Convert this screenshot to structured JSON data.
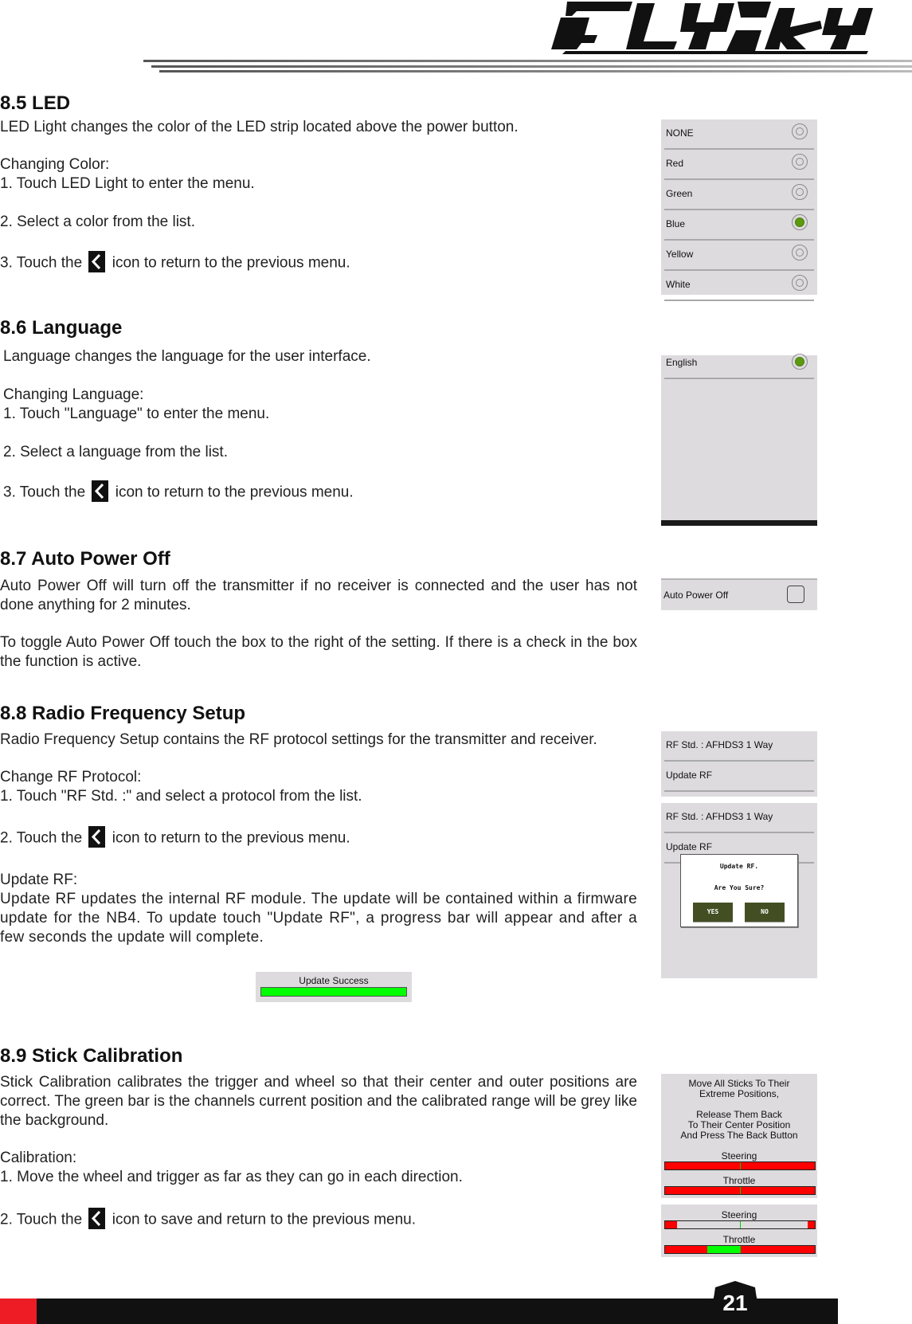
{
  "header": {
    "brand": "FLYSKY"
  },
  "sections": {
    "led": {
      "heading": "8.5 LED",
      "intro": "LED Light changes the color of the LED strip located above the power button.",
      "sub": "Changing Color:",
      "step1": "1. Touch LED Light to enter the menu.",
      "step2": "2. Select a color from the list.",
      "step3_a": "3. Touch the",
      "step3_b": "icon to return to the previous menu.",
      "screen": {
        "options": [
          "NONE",
          "Red",
          "Green",
          "Blue",
          "Yellow",
          "White"
        ],
        "selected": "Blue"
      }
    },
    "language": {
      "heading": "8.6 Language",
      "intro": "Language changes the language for the user interface.",
      "sub": "Changing Language:",
      "step1": "1. Touch \"Language\" to enter the menu.",
      "step2": "2. Select a language from the list.",
      "step3_a": "3. Touch the",
      "step3_b": "icon to return to the previous menu.",
      "screen": {
        "options": [
          "English"
        ],
        "selected": "English"
      }
    },
    "auto_power_off": {
      "heading": "8.7 Auto Power Off",
      "p1": "Auto Power Off will turn off the transmitter if no receiver is connected and the user has not done anything for 2 minutes.",
      "p2": "To toggle Auto Power Off touch the box to the right of the setting. If there is a check in the box the function is active.",
      "screen": {
        "label": "Auto Power Off",
        "checked": false
      }
    },
    "rf": {
      "heading": "8.8 Radio Frequency Setup",
      "intro": "Radio Frequency Setup contains the RF protocol settings for the transmitter and receiver.",
      "sub": "Change RF Protocol:",
      "step1": "1. Touch \"RF Std. :\" and select a protocol from the list.",
      "step2_a": "2. Touch the",
      "step2_b": "icon to return to the previous menu.",
      "update_sub": "Update RF:",
      "update_p": "Update RF updates the internal RF module. The update will be contained within a firmware update for the NB4. To update touch \"Update RF\", a progress bar will appear and after a few seconds the update will complete.",
      "screen1": {
        "rf_std": "RF Std. : AFHDS3 1 Way",
        "update": "Update RF"
      },
      "screen2": {
        "rf_std": "RF Std. : AFHDS3 1 Way",
        "update": "Update RF",
        "dialog_title": "Update RF.",
        "dialog_msg": "Are You Sure?",
        "yes": "YES",
        "no": "NO"
      },
      "progress": {
        "label": "Update Success",
        "percent": 100,
        "color": "#00ff00"
      }
    },
    "calibration": {
      "heading": "8.9 Stick Calibration",
      "intro": "Stick Calibration calibrates the trigger and wheel so that their center and outer positions are correct. The green bar is the channels current position and the calibrated range will be grey like the background.",
      "sub": "Calibration:",
      "step1": "1. Move the wheel and trigger as far as they can go in each direction.",
      "step2_a": "2. Touch the",
      "step2_b": "icon to save and return to the previous menu.",
      "screen1": {
        "line1": "Move All Sticks To Their",
        "line2": "Extreme Positions,",
        "line3": "Release Them Back",
        "line4": "To Their Center Position",
        "line5": "And Press The Back Button",
        "steering_label": "Steering",
        "throttle_label": "Throttle",
        "steering": {
          "calibrated_range": [
            0.5,
            0.5
          ],
          "position": 0.5
        },
        "throttle": {
          "calibrated_range": [
            0.5,
            0.5
          ],
          "position": 0.5
        }
      },
      "screen2": {
        "steering_label": "Steering",
        "throttle_label": "Throttle",
        "steering": {
          "calibrated_range": [
            0.08,
            0.95
          ],
          "position": 0.5
        },
        "throttle": {
          "calibrated_range": [
            0.5,
            0.5
          ],
          "position": 0.5,
          "green_range": [
            0.28,
            0.5
          ]
        }
      }
    }
  },
  "footer": {
    "page_number": "21"
  },
  "colors": {
    "accent_red": "#ee1c25",
    "radio_selected": "#5b9a0e",
    "dialog_button": "#434f22",
    "bar_red": "#ff0000",
    "bar_green": "#00ff00"
  }
}
